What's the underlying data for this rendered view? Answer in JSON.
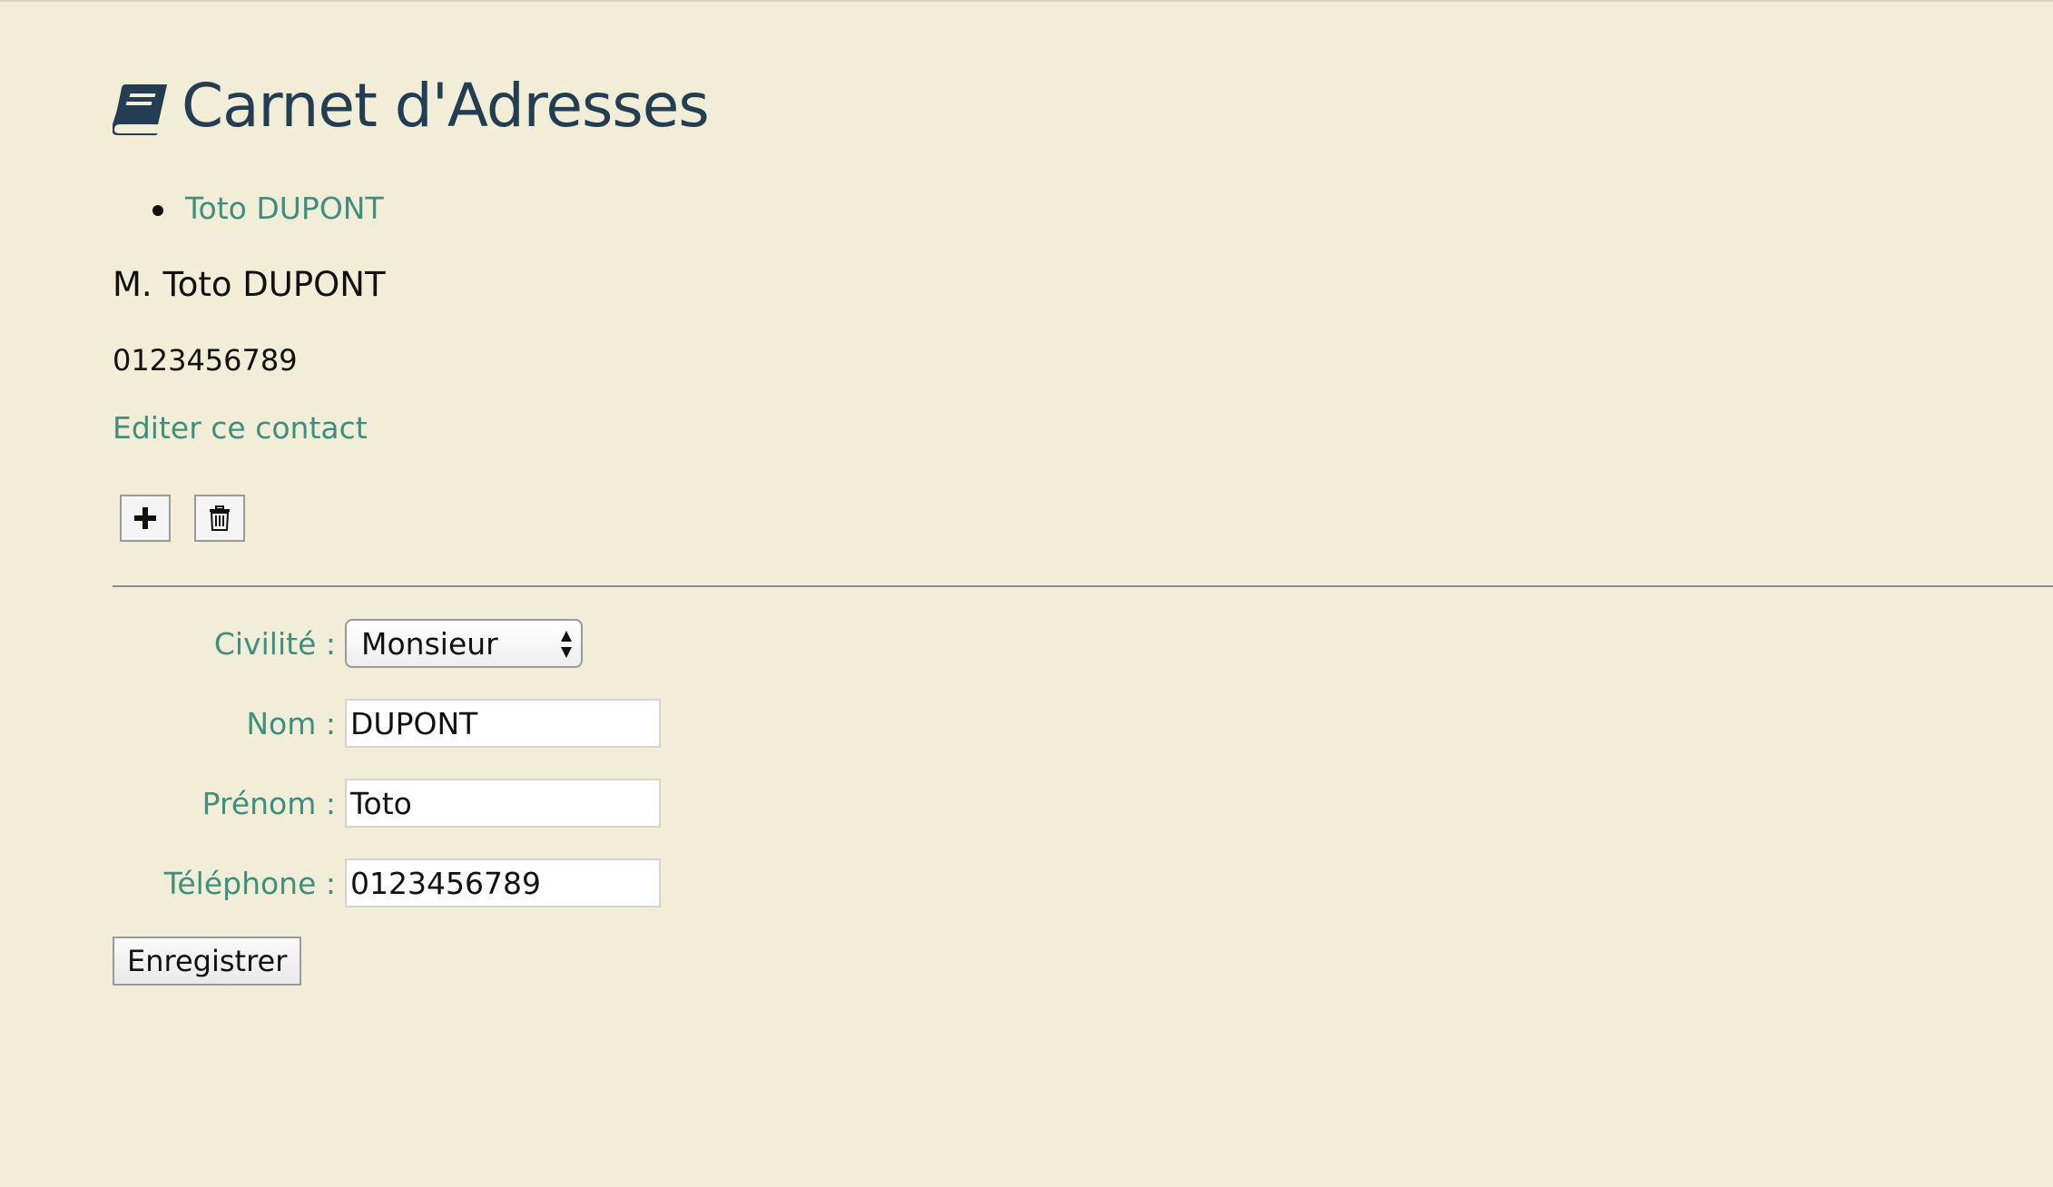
{
  "header": {
    "title": "Carnet d'Adresses",
    "icon": "book-icon"
  },
  "contacts": [
    {
      "label": "Toto DUPONT"
    }
  ],
  "detail": {
    "name": "M. Toto DUPONT",
    "phone": "0123456789",
    "edit_label": "Editer ce contact"
  },
  "actions": {
    "add_icon": "plus-icon",
    "delete_icon": "trash-icon"
  },
  "form": {
    "civilite_label": "Civilité :",
    "civilite_value": "Monsieur",
    "nom_label": "Nom :",
    "nom_value": "DUPONT",
    "prenom_label": "Prénom :",
    "prenom_value": "Toto",
    "telephone_label": "Téléphone :",
    "telephone_value": "0123456789",
    "submit_label": "Enregistrer"
  },
  "colors": {
    "background": "#f2edd7",
    "title": "#233e52",
    "link": "#3f8f80"
  }
}
